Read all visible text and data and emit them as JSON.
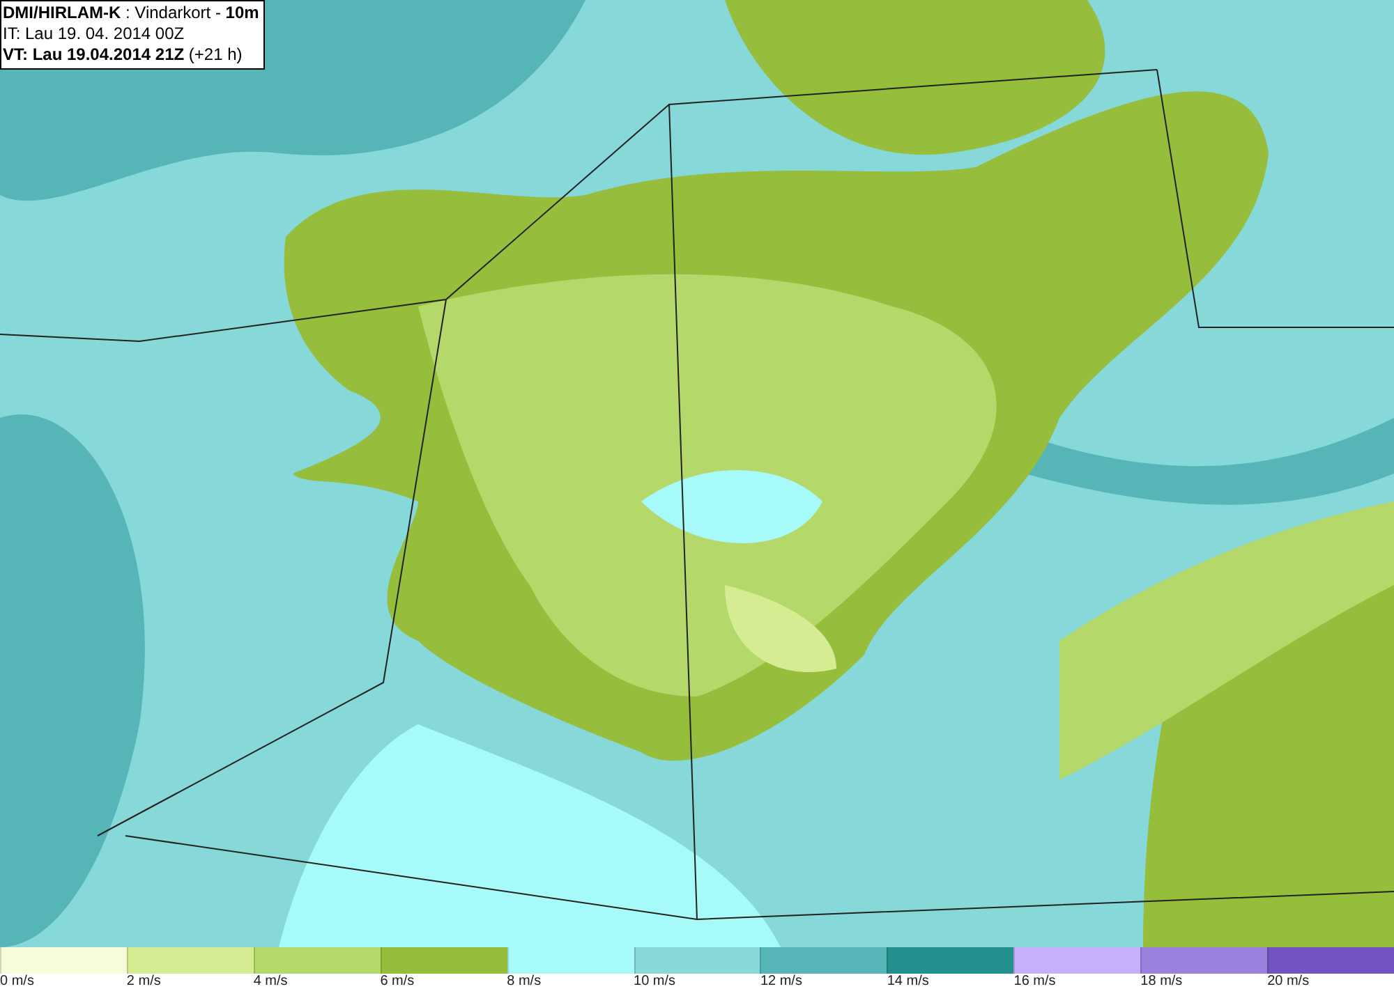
{
  "header": {
    "lines": [
      "**DMI/HIRLAM-K** : Vindarkort - **10m**",
      "IT: Lau 19. 04. 2014 00Z",
      "**VT: Lau 19.04.2014 21Z** (+21 h)"
    ]
  },
  "legend": [
    {
      "label": "0 m/s",
      "color": "#f6fbdc"
    },
    {
      "label": "2 m/s",
      "color": "#d6ec92"
    },
    {
      "label": "4 m/s",
      "color": "#b5d86a"
    },
    {
      "label": "6 m/s",
      "color": "#96bd3c"
    },
    {
      "label": "8 m/s",
      "color": "#a6fbfa"
    },
    {
      "label": "10 m/s",
      "color": "#86d8d9"
    },
    {
      "label": "12 m/s",
      "color": "#56b5b6"
    },
    {
      "label": "14 m/s",
      "color": "#23908e"
    },
    {
      "label": "16 m/s",
      "color": "#c4b1fa"
    },
    {
      "label": "18 m/s",
      "color": "#9a81dd"
    },
    {
      "label": "20 m/s",
      "color": "#7154c0"
    }
  ]
}
